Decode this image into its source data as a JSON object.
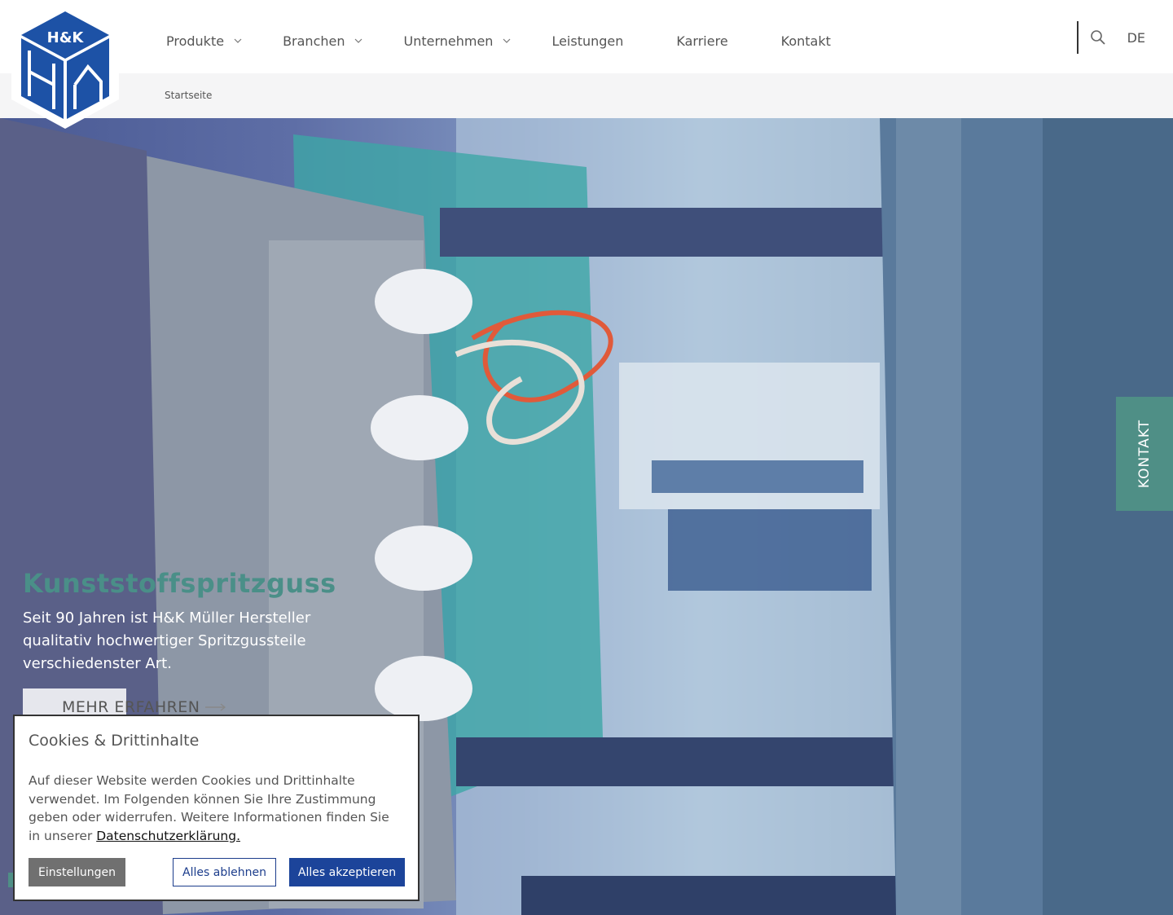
{
  "header": {
    "logo_text": "H&K",
    "nav": [
      {
        "label": "Produkte",
        "has_dropdown": true
      },
      {
        "label": "Branchen",
        "has_dropdown": true
      },
      {
        "label": "Unternehmen",
        "has_dropdown": true
      },
      {
        "label": "Leistungen",
        "has_dropdown": false
      },
      {
        "label": "Karriere",
        "has_dropdown": false
      },
      {
        "label": "Kontakt",
        "has_dropdown": false
      }
    ],
    "search_icon": "search-icon",
    "language": "DE"
  },
  "breadcrumb": {
    "items": [
      "Startseite"
    ]
  },
  "hero": {
    "title": "Kunststoffspritzguss",
    "text": "Seit 90 Jahren ist H&K Müller Hersteller qualitativ hochwertiger Spritzgussteile verschiedenster Art.",
    "button_label": "MEHR ERFAHREN"
  },
  "side_tab": {
    "label": "KONTAKT"
  },
  "cookie_banner": {
    "title": "Cookies & Drittinhalte",
    "text": "Auf dieser Website werden Cookies und Drittinhalte verwendet. Im Folgenden können Sie Ihre Zustimmung geben oder widerrufen. Weitere Informationen finden Sie in unserer ",
    "link_label": "Datenschutzerklärung.",
    "buttons": {
      "settings": "Einstellungen",
      "decline": "Alles ablehnen",
      "accept": "Alles akzeptieren"
    }
  },
  "colors": {
    "brand_blue": "#1c449a",
    "accent_green": "#4f8f86",
    "text_gray": "#555555"
  }
}
